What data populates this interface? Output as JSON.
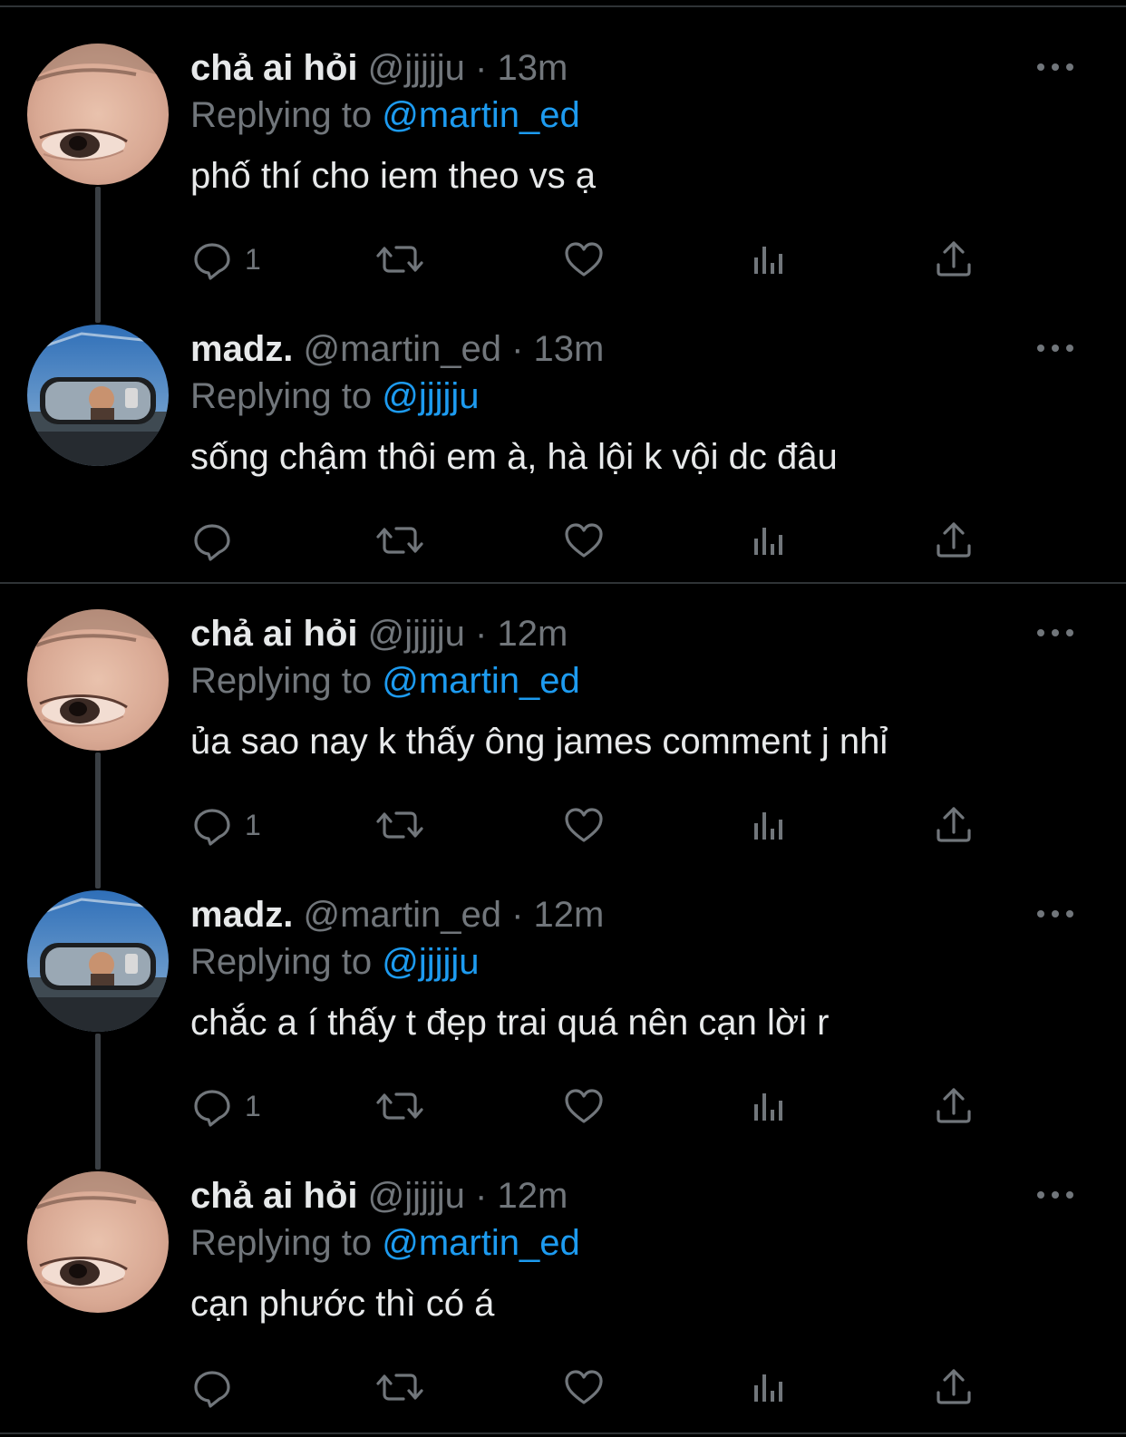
{
  "colors": {
    "background": "#000000",
    "text": "#e7e9ea",
    "secondary": "#71767b",
    "mention": "#1d9bf0",
    "divider": "#2f3336"
  },
  "tweets": [
    {
      "name": "chả ai hỏi",
      "handle": "@jjjjju",
      "time": "· 13m",
      "replying_prefix": "Replying to",
      "replying_to": "@martin_ed",
      "text": "phố thí cho iem theo vs ạ",
      "reply_count": "1",
      "avatar": "eye-closeup-avatar"
    },
    {
      "name": "madz.",
      "handle": "@martin_ed",
      "time": "· 13m",
      "replying_prefix": "Replying to",
      "replying_to": "@jjjjju",
      "text": "sống chậm thôi em à, hà lội k vội dc đâu",
      "reply_count": "",
      "avatar": "car-mirror-avatar"
    },
    {
      "name": "chả ai hỏi",
      "handle": "@jjjjju",
      "time": "· 12m",
      "replying_prefix": "Replying to",
      "replying_to": "@martin_ed",
      "text": "ủa sao nay k thấy ông james comment j nhỉ",
      "reply_count": "1",
      "avatar": "eye-closeup-avatar"
    },
    {
      "name": "madz.",
      "handle": "@martin_ed",
      "time": "· 12m",
      "replying_prefix": "Replying to",
      "replying_to": "@jjjjju",
      "text": "chắc a í thấy t đẹp trai quá nên cạn lời r",
      "reply_count": "1",
      "avatar": "car-mirror-avatar"
    },
    {
      "name": "chả ai hỏi",
      "handle": "@jjjjju",
      "time": "· 12m",
      "replying_prefix": "Replying to",
      "replying_to": "@martin_ed",
      "text": "cạn phước thì có á",
      "reply_count": "",
      "avatar": "eye-closeup-avatar"
    }
  ],
  "icons": [
    "reply-icon",
    "retweet-icon",
    "like-icon",
    "views-icon",
    "share-icon",
    "more-icon"
  ]
}
